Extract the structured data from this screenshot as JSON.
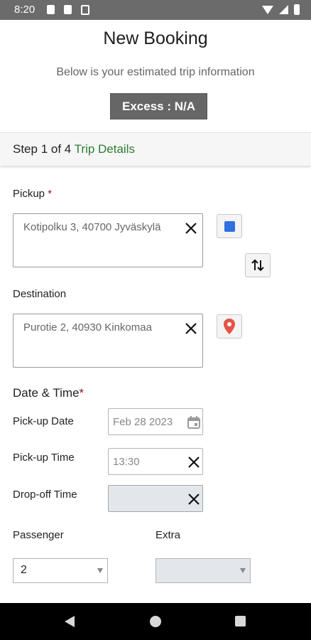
{
  "status_bar": {
    "time": "8:20"
  },
  "header": {
    "title": "New Booking",
    "subtitle": "Below is your estimated trip information",
    "excess_label": "Excess : N/A"
  },
  "step": {
    "prefix": "Step 1 of 4",
    "name": "Trip Details"
  },
  "pickup": {
    "label": "Pickup",
    "required_mark": "*",
    "value": "Kotipolku 3, 40700 Jyväskylä"
  },
  "destination": {
    "label": "Destination",
    "value": "Purotie 2, 40930 Kinkomaa"
  },
  "datetime": {
    "section_label": "Date & Time",
    "required_mark": "*",
    "pickup_date_label": "Pick-up Date",
    "pickup_date_value": "Feb 28 2023",
    "pickup_time_label": "Pick-up Time",
    "pickup_time_value": "13:30",
    "dropoff_time_label": "Drop-off Time",
    "dropoff_time_value": ""
  },
  "passenger": {
    "label": "Passenger",
    "selected": "2"
  },
  "extra": {
    "label": "Extra",
    "selected": ""
  },
  "colors": {
    "accent_green": "#2e7d32",
    "excess_bg": "#666666",
    "pickup_marker": "#2f6fde",
    "destination_marker": "#e45445",
    "disabled_bg": "#e3e7ec"
  },
  "icons": {
    "pickup_marker": "blue-square-icon",
    "swap": "swap-vertical-icon",
    "destination_marker": "map-pin-icon",
    "calendar": "calendar-icon",
    "clear": "close-icon"
  }
}
